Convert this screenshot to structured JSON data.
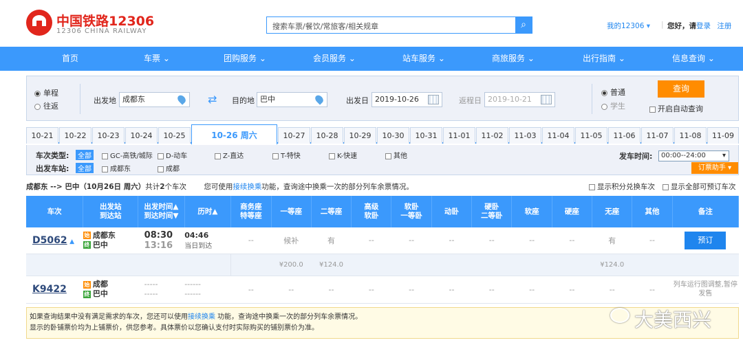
{
  "header": {
    "logo_cn": "中国铁路12306",
    "logo_en": "12306 CHINA RAILWAY",
    "search_placeholder": "搜索车票/餐饮/常旅客/相关规章",
    "my12306": "我的12306",
    "greeting": "您好，请",
    "login": "登录",
    "register": "注册"
  },
  "nav": [
    "首页",
    "车票",
    "团购服务",
    "会员服务",
    "站车服务",
    "商旅服务",
    "出行指南",
    "信息查询"
  ],
  "query": {
    "oneway": "单程",
    "roundtrip": "往返",
    "from_label": "出发地",
    "from_value": "成都东",
    "to_label": "目的地",
    "to_value": "巴中",
    "date_label": "出发日",
    "date_value": "2019-10-26",
    "return_label": "返程日",
    "return_value": "2019-10-21",
    "normal": "普通",
    "student": "学生",
    "query_btn": "查询",
    "auto_query": "开启自动查询"
  },
  "date_tabs": [
    "10-21",
    "10-22",
    "10-23",
    "10-24",
    "10-25",
    "10-26 周六",
    "10-27",
    "10-28",
    "10-29",
    "10-30",
    "10-31",
    "11-01",
    "11-02",
    "11-03",
    "11-04",
    "11-05",
    "11-06",
    "11-07",
    "11-08",
    "11-09"
  ],
  "filters": {
    "type_label": "车次类型:",
    "all": "全部",
    "types": [
      "GC-高铁/城际",
      "D-动车",
      "Z-直达",
      "T-特快",
      "K-快速",
      "其他"
    ],
    "station_label": "出发车站:",
    "stations": [
      "成都东",
      "成都"
    ],
    "depart_time_label": "发车时间:",
    "depart_time_value": "00:00--24:00",
    "helper": "订票助手"
  },
  "route": {
    "summary_a": "成都东 --> 巴中（10月26日 周六）",
    "summary_b": "共计",
    "count": "2",
    "summary_c": "个车次",
    "hint_a": "您可使用",
    "hint_link": "接续换乘",
    "hint_b": "功能，查询途中换乘一次的部分列车余票情况。",
    "points_only": "显示积分兑换车次",
    "all_bookable": "显示全部可预订车次"
  },
  "table": {
    "headers": [
      "车次",
      "出发站\n到达站",
      "出发时间▲\n到达时间▼",
      "历时▲",
      "商务座\n特等座",
      "一等座",
      "二等座",
      "高级\n软卧",
      "软卧\n一等卧",
      "动卧",
      "硬卧\n二等卧",
      "软座",
      "硬座",
      "无座",
      "其他",
      "备注"
    ],
    "rows": [
      {
        "code": "D5062",
        "from": "成都东",
        "to": "巴中",
        "depart": "08:30",
        "arrive": "13:16",
        "duration": "04:46",
        "duration_note": "当日到达",
        "seats": [
          "--",
          "候补",
          "有",
          "--",
          "--",
          "--",
          "--",
          "--",
          "--",
          "有",
          "--"
        ],
        "prices": [
          "",
          "¥200.0",
          "¥124.0",
          "",
          "",
          "",
          "",
          "",
          "",
          "¥124.0",
          ""
        ],
        "action": "预订"
      },
      {
        "code": "K9422",
        "from": "成都",
        "to": "巴中",
        "depart": "-----",
        "arrive": "-----",
        "duration": "------",
        "duration_note": "------",
        "seats": [
          "--",
          "--",
          "--",
          "--",
          "--",
          "--",
          "--",
          "--",
          "--",
          "--",
          "--"
        ],
        "note": "列车运行图调整,暂停发售"
      }
    ]
  },
  "start_badge": "始",
  "end_badge": "终",
  "footer": {
    "line1_a": "如果查询结果中没有满足需求的车次，您还可以使用",
    "line1_link": "接续换乘",
    "line1_b": " 功能，查询途中换乘一次的部分列车余票情况。",
    "line2": "显示的卧铺票价均为上铺票价，供您参考。具体票价以您确认支付时实际购买的铺别票价为准。"
  },
  "watermark": "大美西兴",
  "colors": {
    "brand_red": "#e1261c",
    "nav_blue": "#3b99fc",
    "action_orange": "#ff8c00",
    "available_green": "#229f22"
  }
}
